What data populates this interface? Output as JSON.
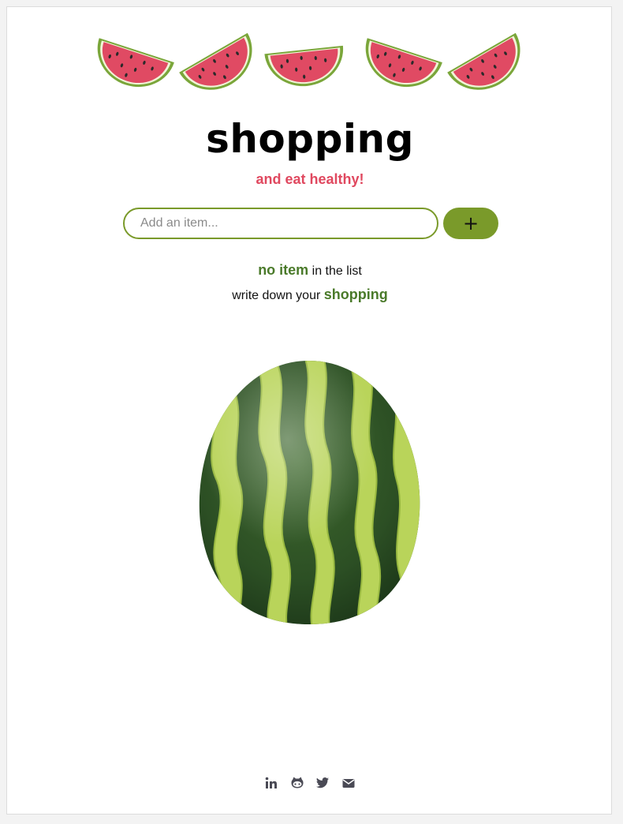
{
  "header": {
    "title": "shopping",
    "subtitle": "and eat healthy!"
  },
  "add_item": {
    "placeholder": "Add an item...",
    "value": "",
    "button_label": "+"
  },
  "status": {
    "line1_highlight": "no item",
    "line1_rest": " in the list",
    "line2_rest": "write down your ",
    "line2_highlight": "shopping"
  },
  "illustrations": {
    "slice_icon": "watermelon-slice",
    "slice_count": 5,
    "main_image": "whole-watermelon"
  },
  "social": [
    {
      "name": "linkedin-icon",
      "label": "in"
    },
    {
      "name": "github-icon",
      "label": "github"
    },
    {
      "name": "twitter-icon",
      "label": "twitter"
    },
    {
      "name": "mail-icon",
      "label": "mail"
    }
  ],
  "colors": {
    "accent_green": "#7a9a2a",
    "text_green": "#4a7a2a",
    "accent_red": "#e0485f",
    "icon_gray": "#4a4a55"
  }
}
